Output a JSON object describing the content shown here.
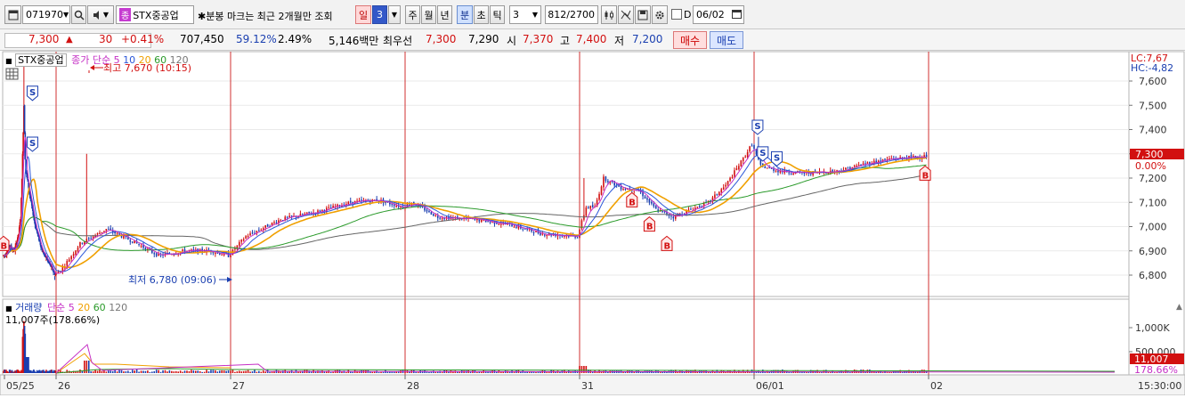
{
  "toolbar": {
    "code": "071970",
    "name": "STX중공업",
    "name_badge": "종",
    "marker_note": "분봉 마크는 최근 2개월만 조회",
    "period_il": "일",
    "period_num": "3",
    "period_ju": "주",
    "period_wol": "월",
    "period_nyeon": "년",
    "period_bun": "분",
    "period_cho": "초",
    "period_tik": "틱",
    "interval": "3",
    "count": "812/2700",
    "checkbox_label": "D",
    "date": "06/02"
  },
  "quote": {
    "price": "7,300",
    "change": "30",
    "change_pct": "+0.41%",
    "volume": "707,450",
    "vol_ratio": "59.12%",
    "turnover": "2.49%",
    "amount": "5,146백만",
    "best_ask_label": "최우선",
    "best_ask": "7,300",
    "best_bid": "7,290",
    "open_label": "시",
    "open": "7,370",
    "high_label": "고",
    "high": "7,400",
    "low_label": "저",
    "low": "7,200",
    "buy_button": "매수",
    "sell_button": "매도"
  },
  "price_panel": {
    "stock_label": "STX중공업",
    "ma_label": "종가 단순",
    "ma_periods": [
      "5",
      "10",
      "20",
      "60",
      "120"
    ],
    "high_marker": "최고 7,670 (10:15)",
    "low_marker": "최저 6,780 (09:06)",
    "lc_label": "LC:7,67",
    "hc_label": "HC:-4,82",
    "current_price_tag": "7,300",
    "current_pct_tag": "0.00%",
    "y_ticks": [
      "7,600",
      "7,500",
      "7,400",
      "7,300",
      "7,200",
      "7,100",
      "7,000",
      "6,900",
      "6,800"
    ]
  },
  "volume_panel": {
    "label": "거래량",
    "ma_label": "단순",
    "ma_periods": [
      "5",
      "20",
      "60",
      "120"
    ],
    "last_value": "11,007주(178.66%)",
    "y_ticks": [
      "1,000K",
      "500,000"
    ],
    "value_tag": "11,007",
    "pct_tag": "178.66%"
  },
  "x_axis": {
    "labels": [
      "05/25",
      "26",
      "27",
      "28",
      "31",
      "06/01",
      "02"
    ],
    "time_label": "15:30:00"
  },
  "colors": {
    "up": "#d21010",
    "down": "#1a3fb0",
    "ma5": "#c52fc5",
    "ma10": "#2a56d8",
    "ma20": "#f0a000",
    "ma60": "#2a9a2a",
    "ma120": "#666666",
    "day_divider": "#d03030"
  },
  "chart_data": {
    "type": "line",
    "x": [
      "05/25",
      "05/26",
      "05/27",
      "05/28",
      "05/31",
      "06/01",
      "06/02"
    ],
    "series": [
      {
        "name": "종가",
        "values": [
          6900,
          7150,
          6870,
          7080,
          7000,
          7230,
          7300
        ]
      }
    ],
    "ylim": [
      6780,
      7670
    ],
    "markers": [
      {
        "type": "S",
        "x": "05/26",
        "y": 7520
      },
      {
        "type": "S",
        "x": "05/26",
        "y": 7310
      },
      {
        "type": "B",
        "x": "05/25",
        "y": 6960
      },
      {
        "type": "B",
        "x": "06/01",
        "y": 7140
      },
      {
        "type": "B",
        "x": "06/01",
        "y": 7040
      },
      {
        "type": "B",
        "x": "06/01",
        "y": 6960
      },
      {
        "type": "S",
        "x": "06/02",
        "y": 7270
      },
      {
        "type": "S",
        "x": "06/02",
        "y": 7380
      },
      {
        "type": "S",
        "x": "06/02",
        "y": 7250
      },
      {
        "type": "B",
        "x": "06/02",
        "y": 7250
      }
    ]
  }
}
